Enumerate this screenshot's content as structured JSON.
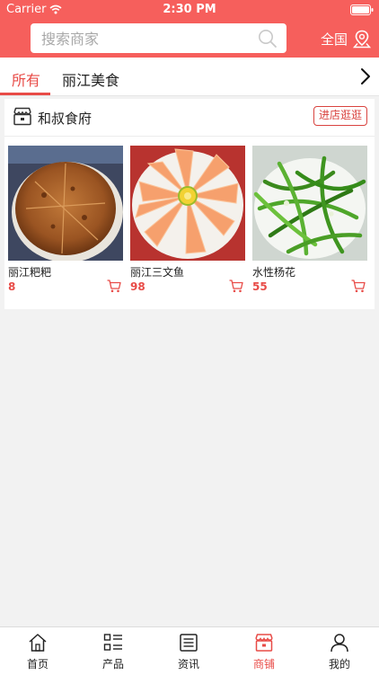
{
  "status_bar": {
    "carrier": "Carrier",
    "time": "2:30 PM"
  },
  "header": {
    "search_placeholder": "搜索商家",
    "region_label": "全国"
  },
  "tabs": [
    {
      "label": "所有",
      "active": true
    },
    {
      "label": "丽江美食",
      "active": false
    }
  ],
  "shop": {
    "name": "和叔食府",
    "enter_label": "进店逛逛",
    "products": [
      {
        "name": "丽江粑粑",
        "price": "8",
        "image": "fried-flatbread-photo"
      },
      {
        "name": "丽江三文鱼",
        "price": "98",
        "image": "salmon-sashimi-photo"
      },
      {
        "name": "水性杨花",
        "price": "55",
        "image": "stirfried-greens-photo"
      }
    ]
  },
  "bottom_nav": [
    {
      "label": "首页",
      "icon": "home-icon",
      "active": false
    },
    {
      "label": "产品",
      "icon": "grid-list-icon",
      "active": false
    },
    {
      "label": "资讯",
      "icon": "news-icon",
      "active": false
    },
    {
      "label": "商铺",
      "icon": "store-icon",
      "active": true
    },
    {
      "label": "我的",
      "icon": "user-icon",
      "active": false
    }
  ],
  "colors": {
    "brand": "#f65f5c",
    "accent": "#e84b47",
    "background": "#f2f2f2"
  }
}
